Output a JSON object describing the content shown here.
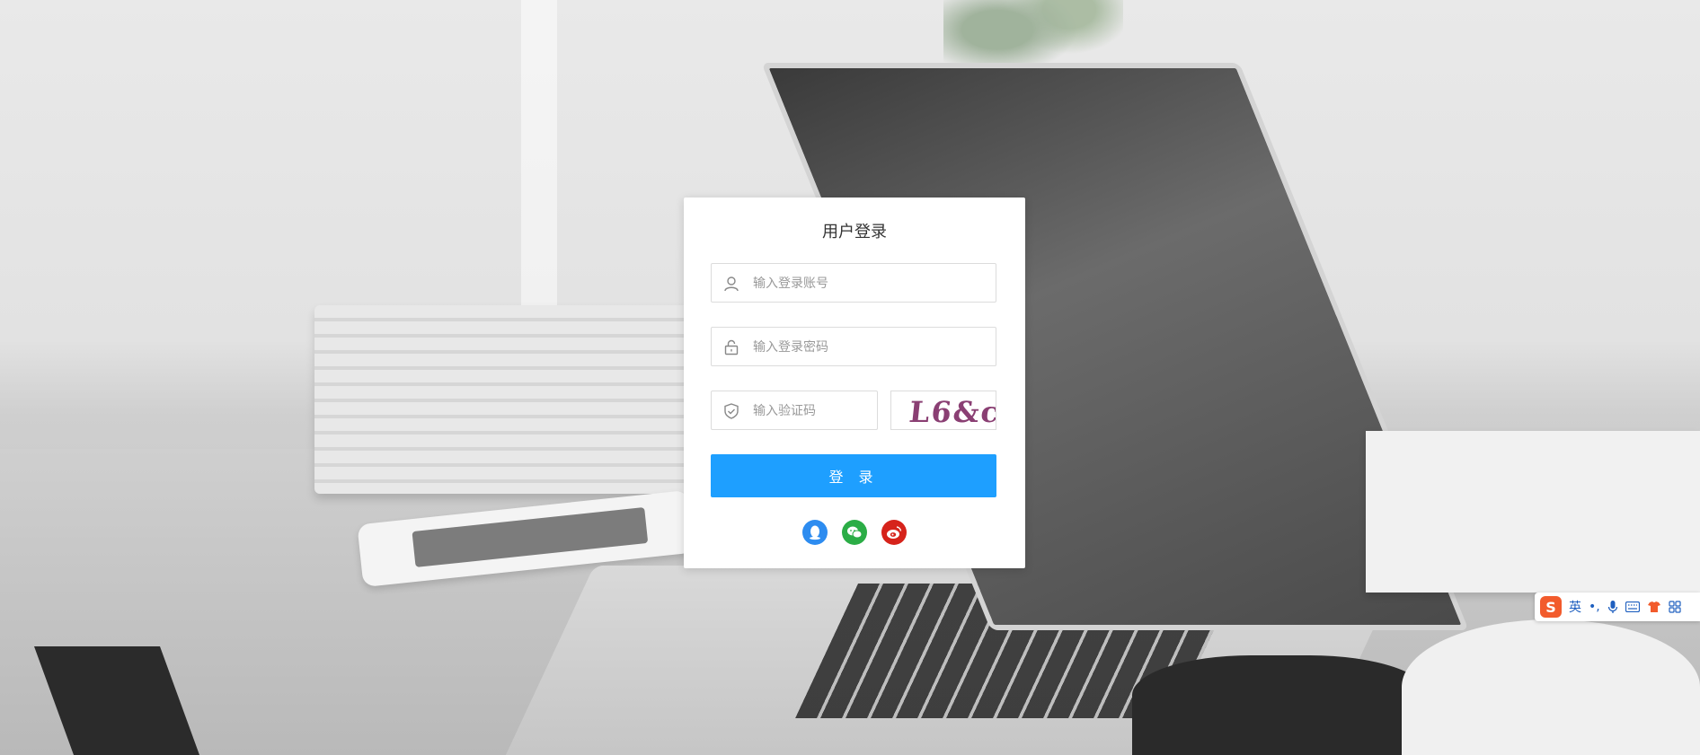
{
  "login": {
    "title": "用户登录",
    "username_placeholder": "输入登录账号",
    "password_placeholder": "输入登录密码",
    "captcha_placeholder": "输入验证码",
    "captcha_text": "L6&c",
    "login_button": "登 录"
  },
  "social": {
    "items": [
      {
        "name": "qq-icon",
        "color": "#2d8cf0"
      },
      {
        "name": "wechat-icon",
        "color": "#2bad46"
      },
      {
        "name": "weibo-icon",
        "color": "#d6231b"
      }
    ]
  },
  "ime_toolbar": {
    "logo": "S",
    "mode": "英",
    "punct": "•,"
  },
  "colors": {
    "primary": "#1e9fff",
    "captcha": "#8a3f73"
  }
}
